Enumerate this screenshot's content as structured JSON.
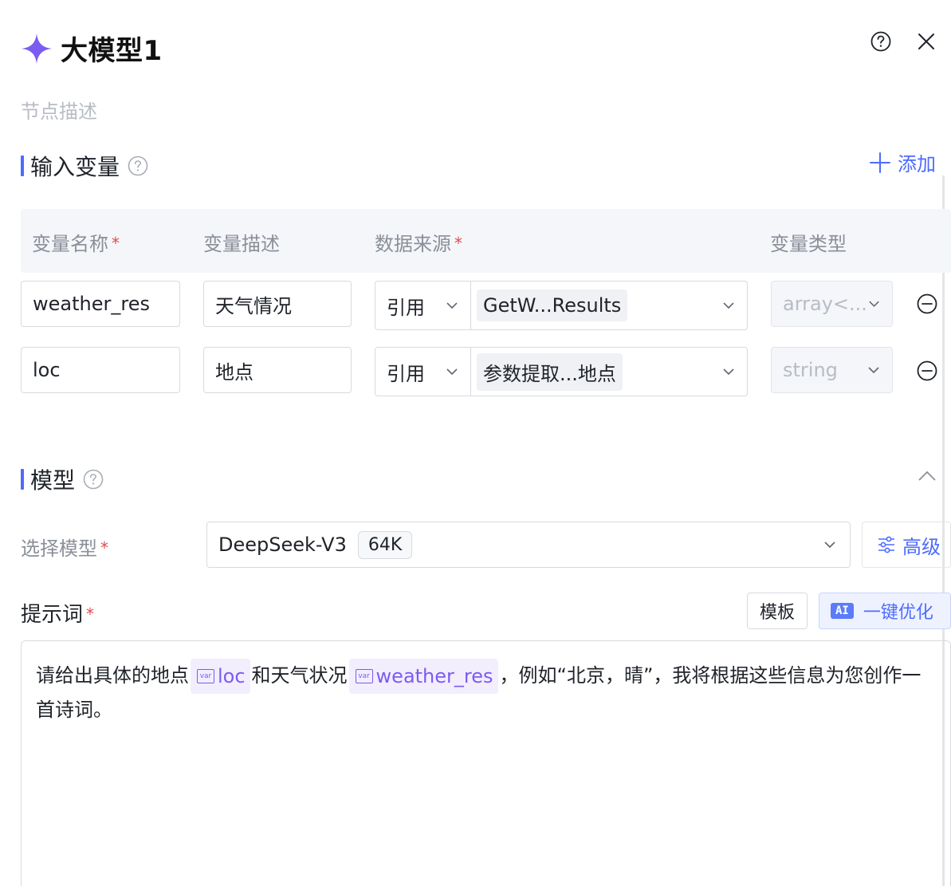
{
  "header": {
    "title": "大模型1"
  },
  "node_desc_placeholder": "节点描述",
  "inputs_section": {
    "title": "输入变量",
    "add_label": "添加",
    "columns": [
      "变量名称",
      "变量描述",
      "数据来源",
      "变量类型"
    ],
    "required_mark": "*",
    "rows": [
      {
        "name": "weather_res",
        "desc": "天气情况",
        "source_type": "引用",
        "source_value": "GetW...Results",
        "var_type": "array<..."
      },
      {
        "name": "loc",
        "desc": "地点",
        "source_type": "引用",
        "source_value": "参数提取...地点",
        "var_type": "string"
      }
    ]
  },
  "model_section": {
    "title": "模型",
    "select_label": "选择模型",
    "model_name": "DeepSeek-V3",
    "context": "64K",
    "advanced_label": "高级"
  },
  "prompt_section": {
    "label": "提示词",
    "template_button": "模板",
    "ai_badge": "AI",
    "optimize_button": "一键优化",
    "var_icon_text": "var",
    "text_1": "请给出具体的地点",
    "var_1": "loc",
    "text_2": "和天气状况",
    "var_2": "weather_res",
    "text_3": "，例如“北京，晴”，我将根据这些信息为您创作一首诗词。"
  },
  "colors": {
    "accent": "#4d6bfe",
    "star": "#7b5cf0",
    "required": "#e5484d",
    "var_chip_bg": "#f2eefe",
    "var_chip_text": "#7b5cf0"
  },
  "icons": [
    "sparkle-icon",
    "help-icon",
    "close-icon",
    "plus-icon",
    "chevron-down-icon",
    "minus-circle-icon",
    "chevron-up-icon",
    "sliders-icon",
    "var-icon"
  ]
}
